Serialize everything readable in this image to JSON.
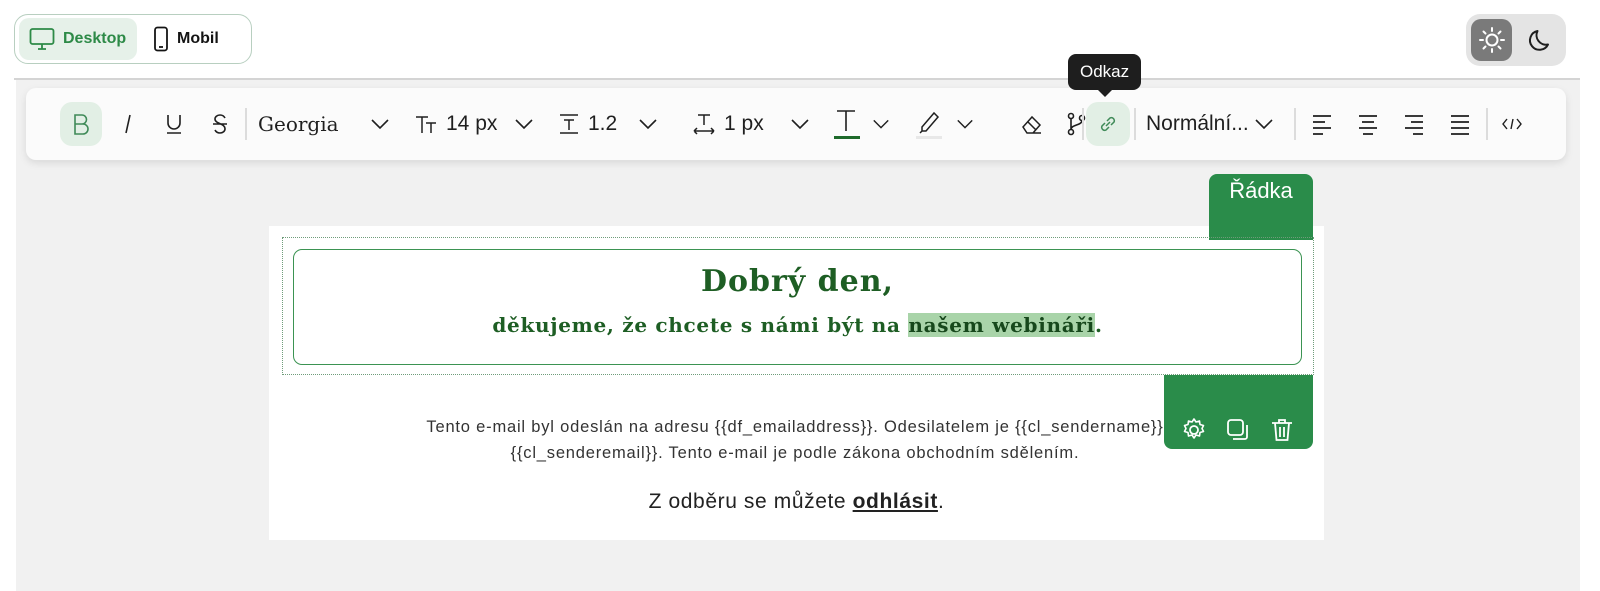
{
  "view_switch": {
    "desktop_label": "Desktop",
    "mobile_label": "Mobil"
  },
  "toolbar": {
    "font_family": "Georgia",
    "font_size": "14 px",
    "line_height": "1.2",
    "letter_spacing": "1 px",
    "paragraph_style": "Normální...",
    "tooltip": "Odkaz",
    "text_color": "#1e6a2b"
  },
  "row_tab": {
    "label": "Řádka"
  },
  "email": {
    "heading": "Dobrý den,",
    "subheading_prefix": "děkujeme, že chcete s námi být na ",
    "subheading_highlight": "našem webináři",
    "subheading_suffix": ".",
    "footer_line1": "Tento e-mail byl odeslán na adresu {{df_emailaddress}}. Odesilatelem je {{cl_sendername}}",
    "footer_line2": "{{cl_senderemail}}. Tento e-mail je podle zákona obchodním sdělením.",
    "unsub_prefix": "Z odběru se můžete ",
    "unsub_link": "odhlásit",
    "unsub_suffix": "."
  },
  "colors": {
    "accent": "#2a8c4a",
    "highlight": "#a9d4a9",
    "heading": "#1e5e24"
  }
}
